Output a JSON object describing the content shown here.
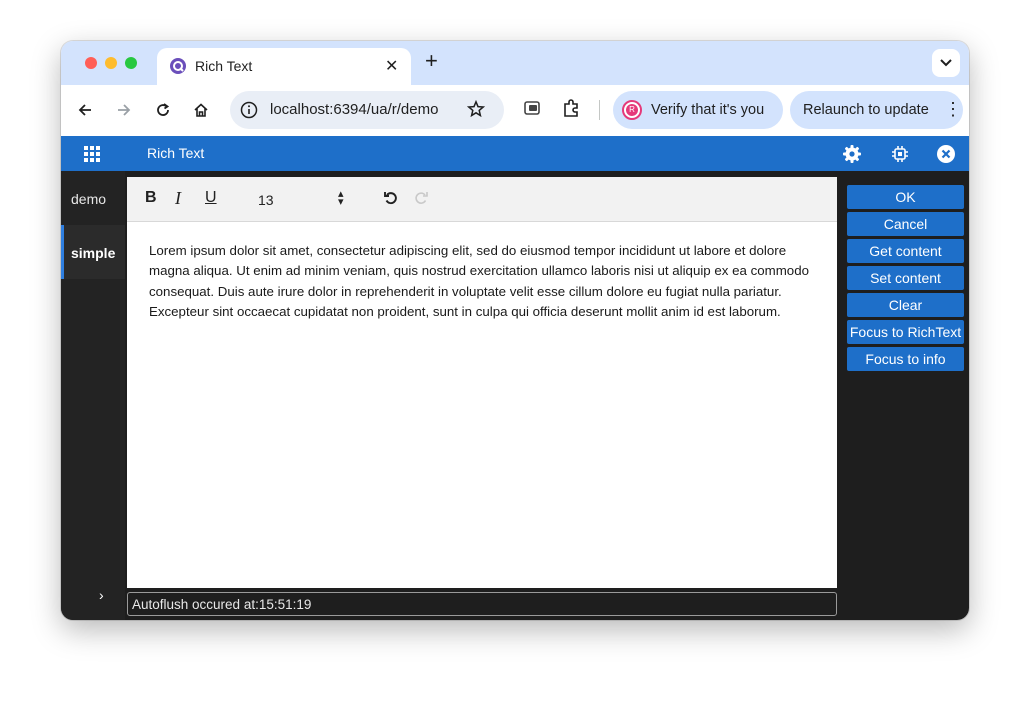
{
  "browser": {
    "tab_title": "Rich Text",
    "tab_close": "✕",
    "new_tab": "+",
    "url": "localhost:6394/ua/r/demo",
    "verify_text": "Verify that it's you",
    "avatar_letter": "R",
    "relaunch_text": "Relaunch to update",
    "more_glyph": "⋮"
  },
  "app": {
    "title": "Rich Text",
    "accent_color": "#1e6fc9"
  },
  "sidebar": {
    "items": [
      {
        "label": "demo"
      },
      {
        "label": "simple"
      }
    ],
    "expand_glyph": "›"
  },
  "editor": {
    "bold": "B",
    "italic": "I",
    "underline": "U",
    "font_size": "13",
    "content": "Lorem ipsum dolor sit amet, consectetur adipiscing elit, sed do eiusmod tempor incididunt ut labore et dolore magna aliqua. Ut enim ad minim veniam, quis nostrud exercitation ullamco laboris nisi ut aliquip ex ea commodo consequat. Duis aute irure dolor in reprehenderit in voluptate velit esse cillum dolore eu fugiat nulla pariatur. Excepteur sint occaecat cupidatat non proident, sunt in culpa qui officia deserunt mollit anim id est laborum."
  },
  "status": {
    "text": "Autoflush occured at:15:51:19"
  },
  "actions": [
    {
      "label": "OK"
    },
    {
      "label": "Cancel"
    },
    {
      "label": "Get content"
    },
    {
      "label": "Set content"
    },
    {
      "label": "Clear"
    },
    {
      "label": "Focus to RichText"
    },
    {
      "label": "Focus to info"
    }
  ]
}
